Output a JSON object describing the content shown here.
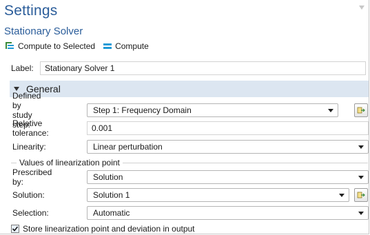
{
  "header": {
    "title": "Settings",
    "subtitle": "Stationary Solver"
  },
  "toolbar": {
    "compute_to_selected": "Compute to Selected",
    "compute": "Compute"
  },
  "label_field": {
    "label": "Label:",
    "value": "Stationary Solver 1"
  },
  "section": {
    "title": "General"
  },
  "fields": {
    "defined_by_study_step": {
      "label": "Defined by study step:",
      "value": "Step 1: Frequency Domain"
    },
    "relative_tolerance": {
      "label": "Relative tolerance:",
      "value": "0.001"
    },
    "linearity": {
      "label": "Linearity:",
      "value": "Linear perturbation"
    }
  },
  "linearization_group": {
    "title": "Values of linearization point",
    "prescribed_by": {
      "label": "Prescribed by:",
      "value": "Solution"
    },
    "solution": {
      "label": "Solution:",
      "value": "Solution 1"
    },
    "selection": {
      "label": "Selection:",
      "value": "Automatic"
    }
  },
  "store_checkbox": {
    "label": "Store linearization point and deviation in output",
    "checked": true
  },
  "colors": {
    "accent": "#2b5d9a",
    "section_bg": "#dce6f1",
    "compute_icon": "#1f9ad6"
  },
  "icons": {
    "compute_to_selected": "compute-to-selected-icon",
    "compute": "compute-icon",
    "goto": "go-to-source-icon"
  }
}
